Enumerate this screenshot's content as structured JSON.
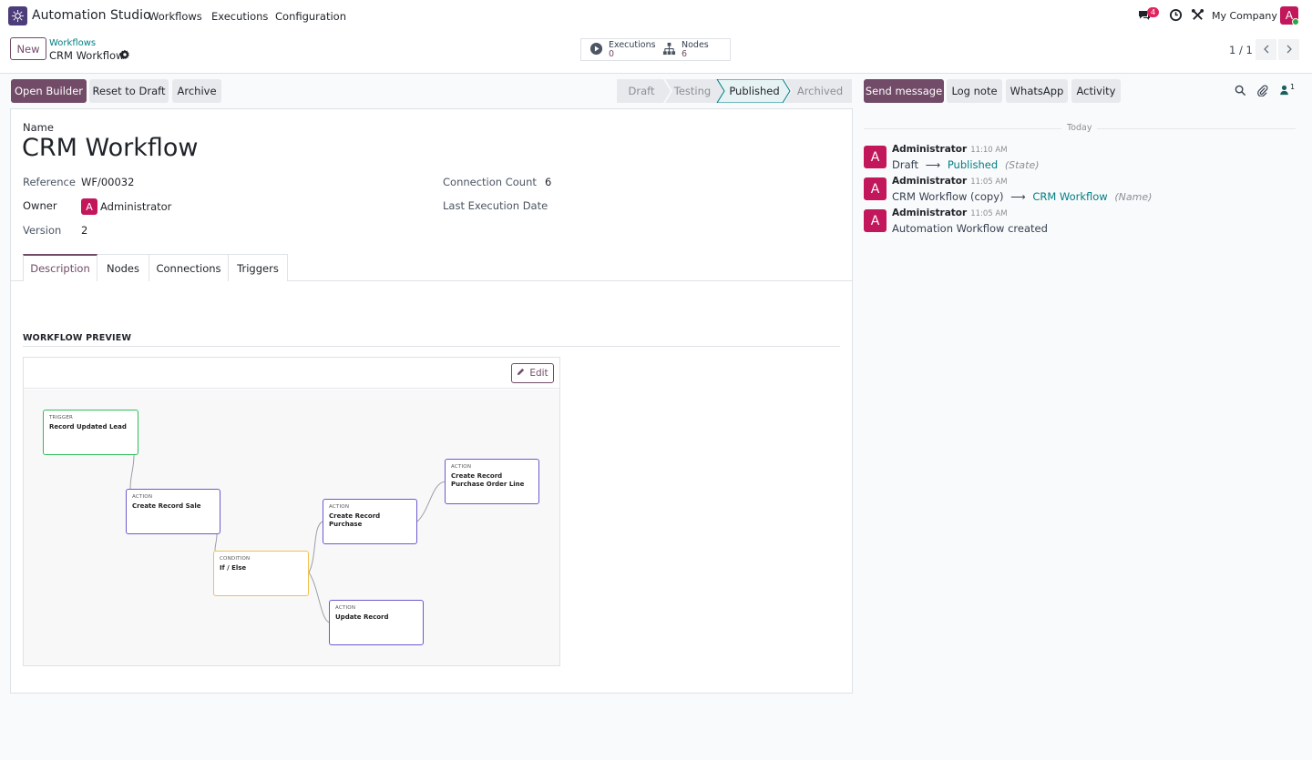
{
  "navbar": {
    "app_name": "Automation Studio",
    "menu": [
      "Workflows",
      "Executions",
      "Configuration"
    ],
    "messages_count": "4",
    "company": "My Company",
    "user_initial": "A"
  },
  "control_panel": {
    "new_label": "New",
    "breadcrumb_parent": "Workflows",
    "breadcrumb_current": "CRM Workflow",
    "stat_executions_label": "Executions",
    "stat_executions_value": "0",
    "stat_nodes_label": "Nodes",
    "stat_nodes_value": "6",
    "pager": "1 / 1"
  },
  "actions": {
    "open_builder": "Open Builder",
    "reset_to_draft": "Reset to Draft",
    "archive": "Archive"
  },
  "statusbar": {
    "stages": [
      "Draft",
      "Testing",
      "Published",
      "Archived"
    ],
    "active": "Published"
  },
  "form": {
    "name_label": "Name",
    "name_value": "CRM Workflow",
    "reference_label": "Reference",
    "reference_value": "WF/00032",
    "owner_label": "Owner",
    "owner_value": "Administrator",
    "owner_initial": "A",
    "version_label": "Version",
    "version_value": "2",
    "connection_count_label": "Connection Count",
    "connection_count_value": "6",
    "last_execution_label": "Last Execution Date",
    "tabs": [
      "Description",
      "Nodes",
      "Connections",
      "Triggers"
    ],
    "active_tab": "Description",
    "preview_title": "WORKFLOW PREVIEW",
    "edit_label": "Edit"
  },
  "workflow": {
    "nodes": [
      {
        "kind": "TRIGGER",
        "name": "Record Updated Lead"
      },
      {
        "kind": "ACTION",
        "name": "Create Record Sale"
      },
      {
        "kind": "CONDITION",
        "name": "If / Else"
      },
      {
        "kind": "ACTION",
        "name": "Create Record Purchase"
      },
      {
        "kind": "ACTION",
        "name": "Create Record Purchase Order Line"
      },
      {
        "kind": "ACTION",
        "name": "Update Record"
      }
    ]
  },
  "chatter": {
    "send_message": "Send message",
    "log_note": "Log note",
    "whatsapp": "WhatsApp",
    "activity": "Activity",
    "followers_count": "1",
    "date_separator": "Today",
    "messages": [
      {
        "author": "Administrator",
        "time": "11:10 AM",
        "old": "Draft",
        "arrow": "⟶",
        "new": "Published",
        "field": "(State)",
        "initial": "A"
      },
      {
        "author": "Administrator",
        "time": "11:05 AM",
        "old": "CRM Workflow (copy)",
        "arrow": "⟶",
        "new": "CRM Workflow",
        "field": "(Name)",
        "initial": "A"
      },
      {
        "author": "Administrator",
        "time": "11:05 AM",
        "text": "Automation Workflow created",
        "initial": "A"
      }
    ]
  },
  "colors": {
    "primary": "#714b67",
    "link": "#017e84",
    "avatar": "#c2185b",
    "trigger_border": "#2ebd59",
    "action_border": "#6a5acd",
    "condition_border": "#f0c24a"
  }
}
